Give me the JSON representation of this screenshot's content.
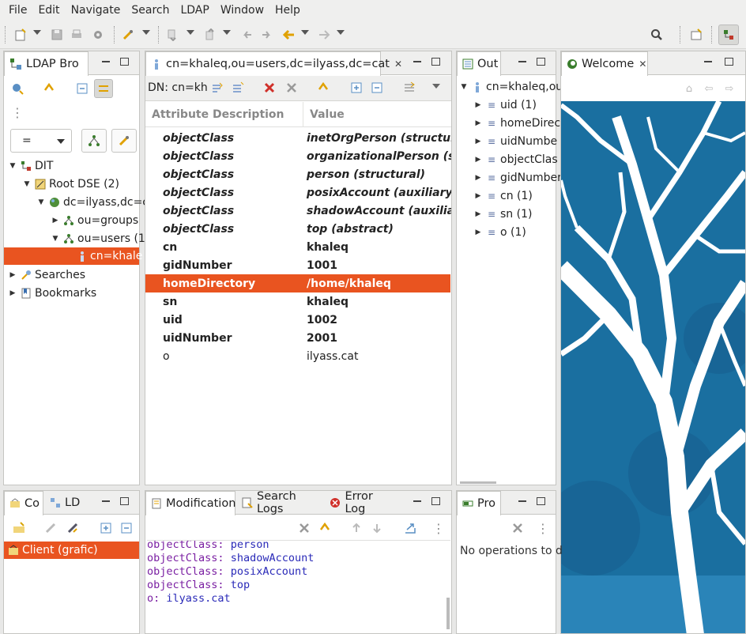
{
  "menu": [
    "File",
    "Edit",
    "Navigate",
    "Search",
    "LDAP",
    "Window",
    "Help"
  ],
  "ldap_browser": {
    "tab_label": "LDAP Bro",
    "filter_value": "=",
    "tree": {
      "dit": "DIT",
      "root_dse": "Root DSE (2)",
      "base": "dc=ilyass,dc=c",
      "groups": "ou=groups",
      "users": "ou=users (1",
      "entry": "cn=khale",
      "searches": "Searches",
      "bookmarks": "Bookmarks"
    }
  },
  "entry_editor": {
    "tab_label": "cn=khaleq,ou=users,dc=ilyass,dc=cat",
    "dn_label": "DN: cn=kh",
    "header_attr": "Attribute Description",
    "header_value": "Value",
    "rows": [
      {
        "attr": "objectClass",
        "value": "inetOrgPerson (structural)"
      },
      {
        "attr": "objectClass",
        "value": "organizationalPerson (stru"
      },
      {
        "attr": "objectClass",
        "value": "person (structural)"
      },
      {
        "attr": "objectClass",
        "value": "posixAccount (auxiliary)"
      },
      {
        "attr": "objectClass",
        "value": "shadowAccount (auxiliary,"
      },
      {
        "attr": "objectClass",
        "value": "top (abstract)"
      },
      {
        "attr": "cn",
        "value": "khaleq"
      },
      {
        "attr": "gidNumber",
        "value": "1001"
      },
      {
        "attr": "homeDirectory",
        "value": "/home/khaleq"
      },
      {
        "attr": "sn",
        "value": "khaleq"
      },
      {
        "attr": "uid",
        "value": "1002"
      },
      {
        "attr": "uidNumber",
        "value": "2001"
      },
      {
        "attr": "o",
        "value": "ilyass.cat"
      }
    ]
  },
  "outline": {
    "tab_label": "Out",
    "root": "cn=khaleq,ou",
    "items": [
      "uid (1)",
      "homeDirec",
      "uidNumbe",
      "objectClas",
      "gidNumber",
      "cn (1)",
      "sn (1)",
      "o (1)"
    ]
  },
  "welcome": {
    "tab_label": "Welcome"
  },
  "connections": {
    "tab1": "Co",
    "tab2": "LD",
    "item": "Client (grafic)"
  },
  "modification": {
    "tab1": "Modification",
    "tab2": "Search Logs",
    "tab3": "Error Log",
    "lines": [
      {
        "key": "objectClass:",
        "value": "person"
      },
      {
        "key": "objectClass:",
        "value": "shadowAccount"
      },
      {
        "key": "objectClass:",
        "value": "posixAccount"
      },
      {
        "key": "objectClass:",
        "value": "top"
      },
      {
        "key": "o:",
        "value": "ilyass.cat"
      }
    ]
  },
  "progress": {
    "tab_label": "Pro",
    "message": "No operations to d"
  },
  "colors": {
    "selection": "#e95420",
    "welcome_bg": "#1a6fa0"
  }
}
